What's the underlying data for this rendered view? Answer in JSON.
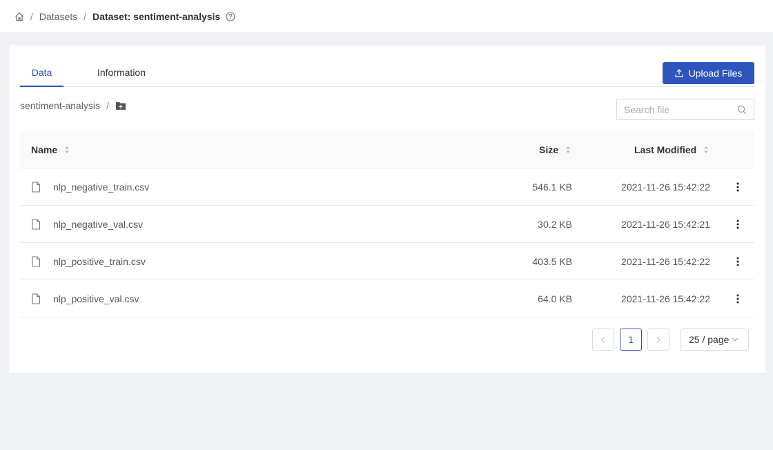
{
  "breadcrumb": {
    "home_icon": "home-icon",
    "separator": "/",
    "datasets_label": "Datasets",
    "current_label": "Dataset: sentiment-analysis",
    "help_icon": "question-circle-icon"
  },
  "tabs": [
    {
      "label": "Data",
      "active": true
    },
    {
      "label": "Information",
      "active": false
    }
  ],
  "toolbar": {
    "upload_label": "Upload Files",
    "upload_icon": "upload-icon"
  },
  "path": {
    "folder": "sentiment-analysis",
    "separator": "/",
    "new_folder_icon": "folder-add-icon"
  },
  "search": {
    "placeholder": "Search file",
    "value": "",
    "icon": "search-icon"
  },
  "table": {
    "columns": {
      "name": "Name",
      "size": "Size",
      "modified": "Last Modified"
    },
    "rows": [
      {
        "name": "nlp_negative_train.csv",
        "size": "546.1 KB",
        "modified": "2021-11-26 15:42:22"
      },
      {
        "name": "nlp_negative_val.csv",
        "size": "30.2 KB",
        "modified": "2021-11-26 15:42:21"
      },
      {
        "name": "nlp_positive_train.csv",
        "size": "403.5 KB",
        "modified": "2021-11-26 15:42:22"
      },
      {
        "name": "nlp_positive_val.csv",
        "size": "64.0 KB",
        "modified": "2021-11-26 15:42:22"
      }
    ]
  },
  "pagination": {
    "current_page": "1",
    "page_size": "25 / page"
  },
  "colors": {
    "accent": "#2e55be",
    "background": "#f0f2f5"
  }
}
